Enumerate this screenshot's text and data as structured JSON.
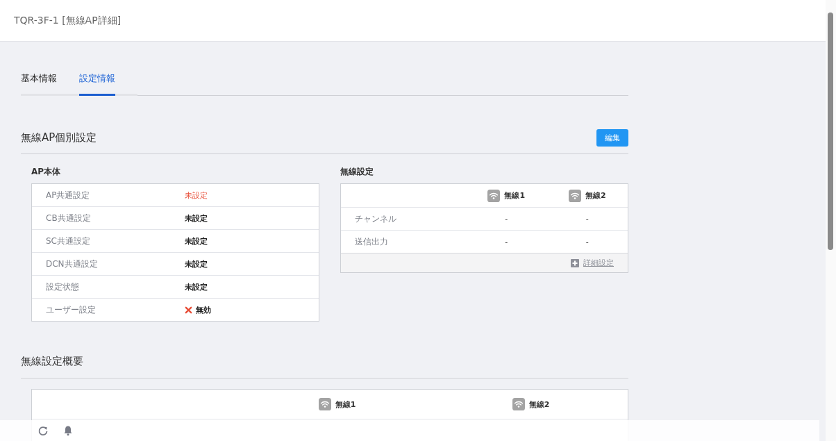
{
  "header": {
    "title": "TQR-3F-1 [無線AP詳細]"
  },
  "tabs": [
    {
      "label": "基本情報",
      "selected": false
    },
    {
      "label": "設定情報",
      "selected": true
    }
  ],
  "individual": {
    "title": "無線AP個別設定",
    "edit_button": "編集",
    "ap_body": {
      "title": "AP本体",
      "rows": [
        {
          "label": "AP共通設定",
          "value": "未設定",
          "kind": "alert"
        },
        {
          "label": "CB共通設定",
          "value": "未設定",
          "kind": "plain"
        },
        {
          "label": "SC共通設定",
          "value": "未設定",
          "kind": "plain"
        },
        {
          "label": "DCN共通設定",
          "value": "未設定",
          "kind": "plain"
        },
        {
          "label": "設定状態",
          "value": "未設定",
          "kind": "plain"
        },
        {
          "label": "ユーザー設定",
          "value": "無効",
          "kind": "disabled"
        }
      ]
    },
    "wireless": {
      "title": "無線設定",
      "columns": [
        "無線1",
        "無線2"
      ],
      "rows": [
        {
          "label": "チャンネル",
          "values": [
            "-",
            "-"
          ]
        },
        {
          "label": "送信出力",
          "values": [
            "-",
            "-"
          ]
        }
      ],
      "detail_link": "詳細設定"
    }
  },
  "overview": {
    "title": "無線設定概要",
    "columns": [
      "無線1",
      "無線2"
    ]
  }
}
